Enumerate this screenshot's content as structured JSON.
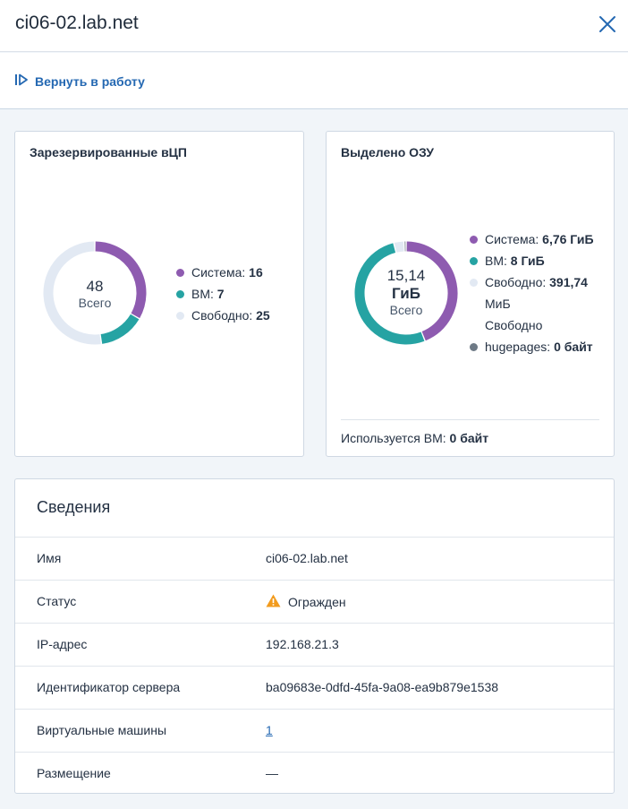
{
  "header": {
    "title": "ci06-02.lab.net",
    "close_icon": "close-icon"
  },
  "toolbar": {
    "action_label": "Вернуть в работу",
    "action_icon": "resume-icon"
  },
  "cpu_card": {
    "title": "Зарезервированные вЦП",
    "total_value": "48",
    "total_label": "Всего",
    "segments": [
      {
        "label": "Система:",
        "value": "16",
        "amount": 16,
        "color": "#8e5bb0"
      },
      {
        "label": "ВМ:",
        "value": "7",
        "amount": 7,
        "color": "#26a3a3"
      },
      {
        "label": "Свободно:",
        "value": "25",
        "amount": 25,
        "color": "#e2e9f3"
      }
    ]
  },
  "ram_card": {
    "title": "Выделено ОЗУ",
    "total_value": "15,14",
    "total_unit": "ГиБ",
    "total_label": "Всего",
    "legend": [
      {
        "label": "Система:",
        "value": "6,76 ГиБ",
        "color": "#8e5bb0"
      },
      {
        "label": "ВМ:",
        "value": "8 ГиБ",
        "color": "#26a3a3"
      },
      {
        "label": "Свободно:",
        "value": "391,74",
        "value2": "МиБ",
        "color": "#e2e9f3"
      },
      {
        "label": "Свободно",
        "label2": "hugepages:",
        "value": "0 байт",
        "color": "#6e7a86"
      }
    ],
    "segment_amounts": {
      "system": 6.76,
      "vm": 8,
      "free": 0.38,
      "hugepages": 0
    },
    "used_by_vm_label": "Используется ВМ:",
    "used_by_vm_value": "0 байт"
  },
  "details": {
    "title": "Сведения",
    "rows": [
      {
        "label": "Имя",
        "value": "ci06-02.lab.net"
      },
      {
        "label": "Статус",
        "value": "Огражден",
        "icon": "warning-icon",
        "icon_color": "#f29b1d"
      },
      {
        "label": "IP-адрес",
        "value": "192.168.21.3"
      },
      {
        "label": "Идентификатор сервера",
        "value": "ba09683e-0dfd-45fa-9a08-ea9b879e1538"
      },
      {
        "label": "Виртуальные машины",
        "value": "1"
      },
      {
        "label": "Размещение",
        "value": "—"
      }
    ]
  }
}
